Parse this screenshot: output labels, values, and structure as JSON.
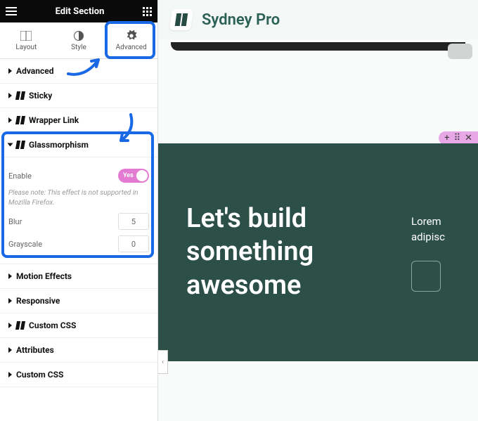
{
  "topbar": {
    "title": "Edit Section"
  },
  "tabs": [
    {
      "label": "Layout",
      "icon": "layout-icon"
    },
    {
      "label": "Style",
      "icon": "style-icon"
    },
    {
      "label": "Advanced",
      "icon": "gear-icon",
      "active": true
    }
  ],
  "panels": {
    "advanced": "Advanced",
    "sticky": "Sticky",
    "wrapper": "Wrapper Link",
    "glass": {
      "title": "Glassmorphism",
      "enable_label": "Enable",
      "enable_value": "Yes",
      "note": "Please note: This effect is not supported in Mozilla Firefox.",
      "blur_label": "Blur",
      "blur_value": "5",
      "gray_label": "Grayscale",
      "gray_value": "0"
    },
    "motion": "Motion Effects",
    "responsive": "Responsive",
    "custom_css1": "Custom CSS",
    "attributes": "Attributes",
    "custom_css2": "Custom CSS"
  },
  "preview": {
    "site_title": "Sydney Pro",
    "hero_heading": "Let's build something awesome",
    "hero_text": "Lorem adipisc"
  },
  "colors": {
    "highlight": "#1968e5",
    "hero_bg": "#2c4f47",
    "toggle": "#e37bd3",
    "handle": "#e8a8e8"
  }
}
